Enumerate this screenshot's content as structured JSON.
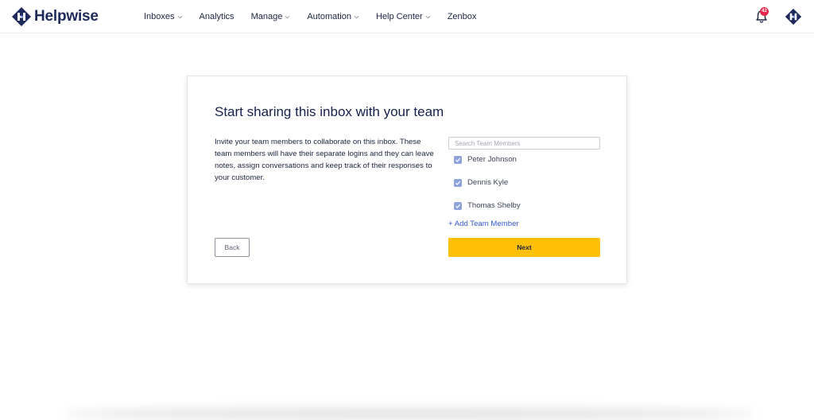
{
  "brand": {
    "name": "Helpwise",
    "accent": "#1e2a5c"
  },
  "nav": {
    "items": [
      {
        "label": "Inboxes",
        "has_dropdown": true
      },
      {
        "label": "Analytics",
        "has_dropdown": false
      },
      {
        "label": "Manage",
        "has_dropdown": true
      },
      {
        "label": "Automation",
        "has_dropdown": true
      },
      {
        "label": "Help Center",
        "has_dropdown": true
      },
      {
        "label": "Zenbox",
        "has_dropdown": false
      }
    ]
  },
  "notifications": {
    "icon": "bell-icon",
    "badge_count": "42",
    "badge_color": "#e5284b"
  },
  "card": {
    "title": "Start sharing this inbox with your team",
    "description": "Invite your team members to collaborate on this inbox. These team members will have their separate logins and they can leave notes, assign conversations and keep track of their responses to your customer.",
    "search": {
      "placeholder": "Search Team Members",
      "value": ""
    },
    "members": [
      {
        "name": "Peter Johnson",
        "checked": true
      },
      {
        "name": "Dennis Kyle",
        "checked": true
      },
      {
        "name": "Thomas Shelby",
        "checked": true
      }
    ],
    "add_member_label": "+ Add Team Member",
    "back_label": "Back",
    "next_label": "Next",
    "next_color": "#ffc107",
    "link_color": "#2f5ac8"
  }
}
